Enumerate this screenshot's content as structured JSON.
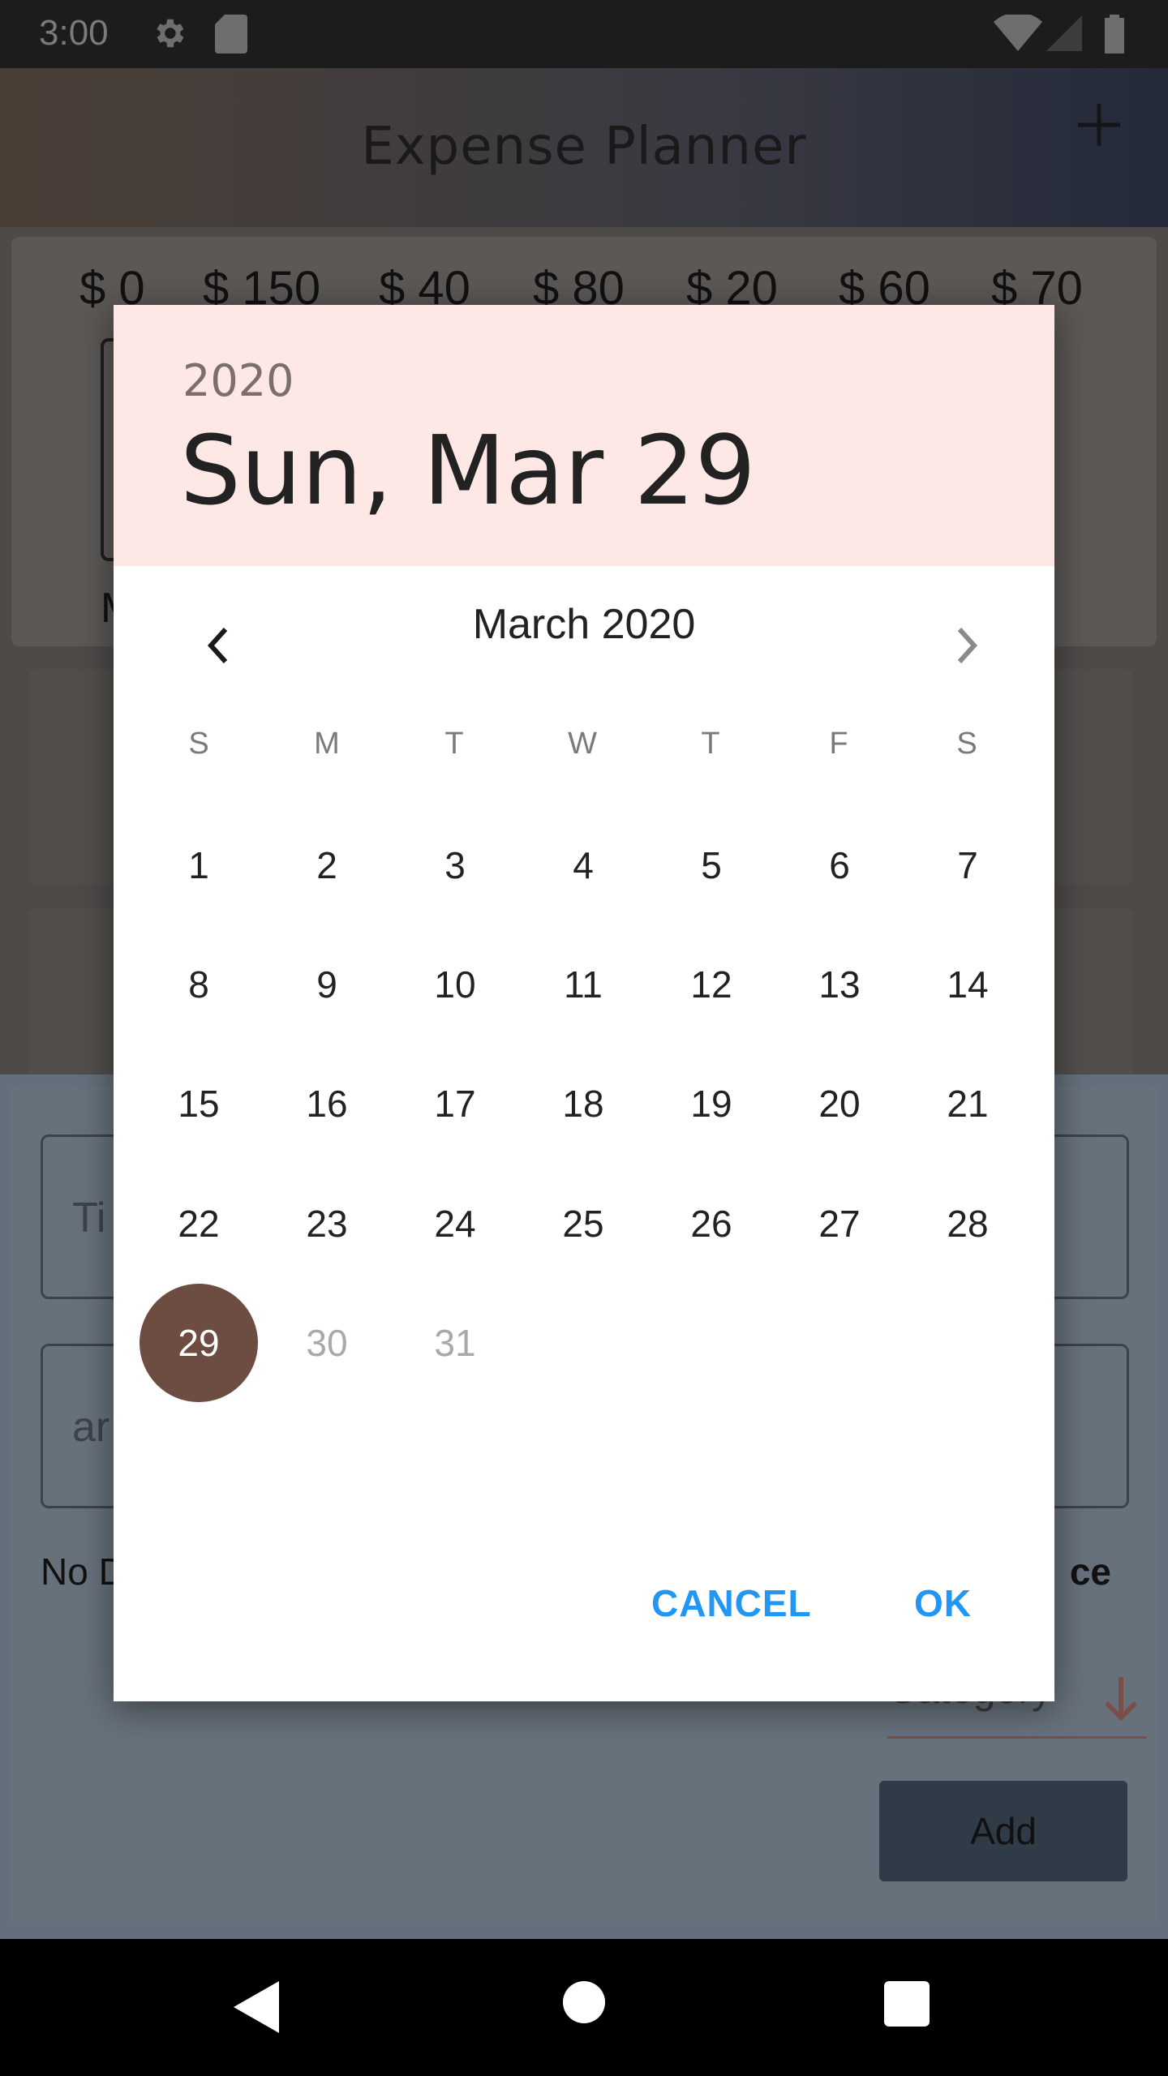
{
  "status_bar": {
    "time": "3:00"
  },
  "app_bar": {
    "title": "Expense Planner"
  },
  "chart": {
    "amounts": [
      "$ 0",
      "$ 150",
      "$ 40",
      "$ 80",
      "$ 20",
      "$ 60",
      "$ 70"
    ],
    "first_day_partial": "M"
  },
  "form": {
    "title_partial": "Ti",
    "amount_partial": "ar",
    "no_date_partial": "No D",
    "choose_partial": "ce",
    "category_partial": "Category",
    "add_label": "Add"
  },
  "date_picker": {
    "year": "2020",
    "selected_date": "Sun, Mar 29",
    "month_label": "March 2020",
    "weekdays": [
      "S",
      "M",
      "T",
      "W",
      "T",
      "F",
      "S"
    ],
    "selected_day": 29,
    "cancel_label": "CANCEL",
    "ok_label": "OK"
  }
}
